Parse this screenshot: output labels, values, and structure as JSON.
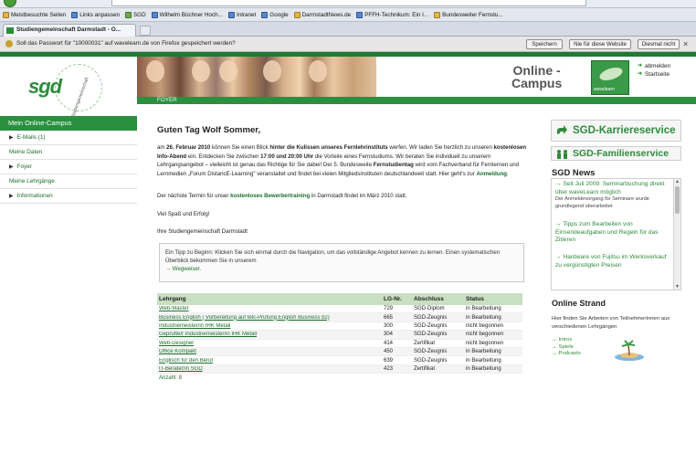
{
  "browser": {
    "bookmarks": [
      "Meistbesuchte Seiten",
      "Links anpassen",
      "SGD",
      "Wilhelm Büchner Hoch...",
      "Intranet",
      "Google",
      "DarmstadtNews.de",
      "PFFH-Technikum: Ein I...",
      "Bundesweiter Fernstu..."
    ],
    "tab_title": "Studiengemeinschaft Darmstadt - O...",
    "password_prompt": "Soll das Passwort für \"10000031\" auf wavelearn.de von Firefox gespeichert werden?",
    "btn_save": "Speichern",
    "btn_never": "Nie für diese Website",
    "btn_not_now": "Diesmal nicht",
    "close_glyph": "×"
  },
  "header": {
    "logo_text": "sgd",
    "logo_ring_text": "Studiengemeinschaft",
    "online_campus_line1": "Online -",
    "online_campus_line2": "Campus",
    "wavelearn_label": "wavelearn",
    "link_logout": "abmelden",
    "link_home": "Startseite",
    "foyer_label": "FOYER"
  },
  "sidebar": {
    "header": "Mein Online-Campus",
    "items": [
      {
        "label": "E-Mails (1)",
        "arrow": "▶"
      },
      {
        "label": "Meine Daten",
        "arrow": ""
      },
      {
        "label": "Foyer",
        "arrow": "▶"
      },
      {
        "label": "Meine Lehrgänge",
        "arrow": ""
      },
      {
        "label": "Informationen",
        "arrow": "▶"
      }
    ]
  },
  "main": {
    "greeting": "Guten Tag Wolf Sommer,",
    "intro": {
      "p1": "am ",
      "date": "26. Februar 2010",
      "p2": " können Sie einen Blick ",
      "behind": "hinter die Kulissen unseres Fernlehrinstituts",
      "p3": " werfen. Wir laden Sie herzlich zu unseren ",
      "infoabend": "kostenlosen Info-Abend",
      "p4": " ein. Entdecken Sie zwischen ",
      "time": "17:00 und 20:00 Uhr",
      "p5": " die Vorteile eines Fernstudiums. Wir beraten Sie individuell zu unserem Lehrgangsangebot – vielleicht ist genau das Richtige für Sie dabei! Der 5. Bundesweite ",
      "fernstudientag": "Fernstudientag",
      "p6": " wird vom Fachverband für Fernlernen und Lernmedien „Forum DistancE-Learning\" veranstaltet und findet bei vielen Mitgliedsinstituten deutschlandweit statt. Hier geht's zur ",
      "anmeldung": "Anmeldung",
      "p7": "."
    },
    "training_p1": "Der nächste Termin für unser ",
    "training_link": "kostenloses Bewerbertraining",
    "training_p2": " in Darmstadt findet im März 2010 statt.",
    "wishes": "Viel Spaß und Erfolg!",
    "signature": "Ihre Studiengemeinschaft Darmstadt",
    "tip_text": "Ein Tipp zu Beginn: Klicken Sie sich einmal durch die Navigation, um das vollständige Angebot kennen zu lernen. Einen systematischen Überblick bekommen Sie in unserem",
    "tip_link": "Wegweiser.",
    "table": {
      "headers": [
        "Lehrgang",
        "LG-Nr.",
        "Abschluss",
        "Status"
      ],
      "rows": [
        [
          "Web-Master",
          "729",
          "SGD-Diplom",
          "in Bearbeitung"
        ],
        [
          "Business English ( Vorbereitung auf telc-Prüfung English Business b2)",
          "665",
          "SGD-Zeugnis",
          "in Bearbeitung"
        ],
        [
          "Industriemeister/in IHK Metall",
          "300",
          "SGD-Zeugnis",
          "nicht begonnen"
        ],
        [
          "Geprüfte/r Industriemeister/in IHK Metall",
          "304",
          "SGD-Zeugnis",
          "nicht begonnen"
        ],
        [
          "Web-Designer",
          "414",
          "Zertifikat",
          "nicht begonnen"
        ],
        [
          "Office Kompakt",
          "450",
          "SGD-Zeugnis",
          "in Bearbeitung"
        ],
        [
          "Englisch für den Beruf",
          "639",
          "SGD-Zeugnis",
          "in Bearbeitung"
        ],
        [
          "IT-Berater/in SGD",
          "423",
          "Zertifikat",
          "in Bearbeitung"
        ]
      ],
      "count": "Anzahl: 8"
    }
  },
  "right": {
    "karriere": "SGD-Karriereservice",
    "familie": "SGD-Familienservice",
    "news_title": "SGD News",
    "news": [
      {
        "title": "Seit Juli 2009: Seminarbuchung direkt über waveLearn möglich",
        "sub": "Der Anmeldevorgang für Seminare wurde grundlegend überarbeitet"
      },
      {
        "title": "Tipps zum Bearbeiten von Einsendeaufgaben und Regeln für das Zitieren",
        "sub": ""
      },
      {
        "title": "Hardware von Fujitsu im Werksverkauf zu vergünstigten Preisen",
        "sub": ""
      }
    ],
    "strand_title": "Online Strand",
    "strand_text": "Hier finden Sie Arbeiten von TeilnehmerInnen aus verschiedenen Lehrgängen",
    "strand_links": [
      "Intros",
      "Spiele",
      "Podcasts"
    ]
  },
  "colors": {
    "brand_green": "#2a8f3f",
    "link_green": "#1b6e2c",
    "table_header": "#c9dfc1"
  }
}
